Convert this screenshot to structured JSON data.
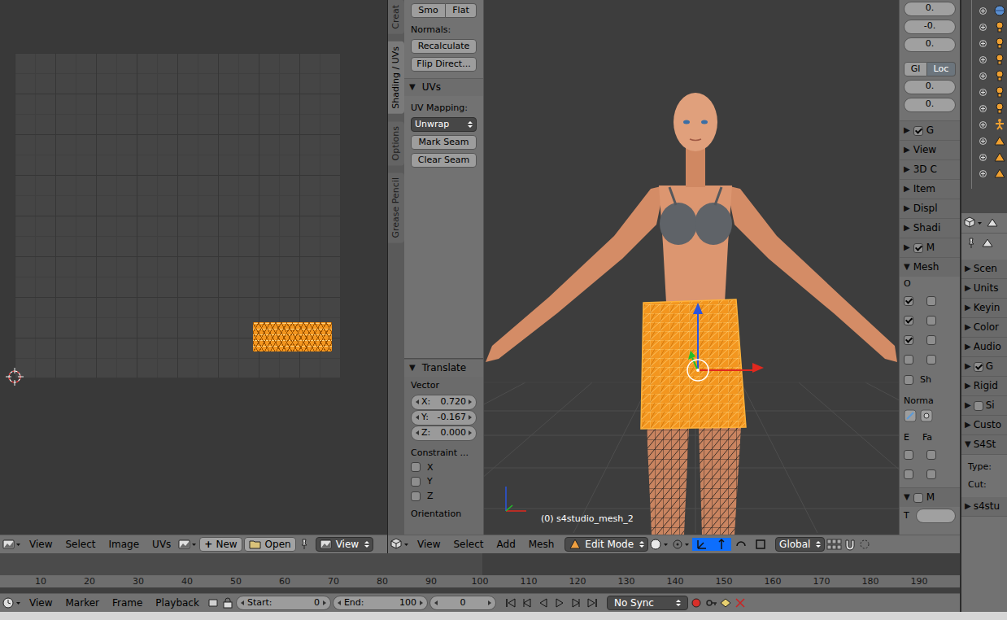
{
  "uv_editor": {
    "header": {
      "menus": [
        "View",
        "Select",
        "Image",
        "UVs"
      ],
      "new_icon": "+",
      "new_label": "New",
      "open_label": "Open",
      "view_label": "View"
    }
  },
  "tool_shelf": {
    "tabs": [
      {
        "label": "Creat",
        "selected": false
      },
      {
        "label": "Shading / UVs",
        "selected": true
      },
      {
        "label": "Options",
        "selected": false
      },
      {
        "label": "Grease Pencil",
        "selected": false
      }
    ],
    "shading_buttons": [
      "Smo",
      "Flat"
    ],
    "normals_label": "Normals:",
    "normals_buttons": [
      "Recalculate",
      "Flip Direct..."
    ],
    "uvs_panel": {
      "arrow": "▼",
      "title": "UVs",
      "mapping_label": "UV Mapping:",
      "mapping_value": "Unwrap",
      "buttons": [
        "Mark Seam",
        "Clear Seam"
      ]
    }
  },
  "operator_panel": {
    "arrow": "▼",
    "title": "Translate",
    "vector_label": "Vector",
    "vector": [
      {
        "label": "X:",
        "value": "0.720"
      },
      {
        "label": "Y:",
        "value": "-0.167"
      },
      {
        "label": "Z:",
        "value": "0.000"
      }
    ],
    "constraint_label": "Constraint ...",
    "constraints": [
      {
        "label": "X",
        "checked": false
      },
      {
        "label": "Y",
        "checked": false
      },
      {
        "label": "Z",
        "checked": false
      }
    ],
    "orientation_label": "Orientation"
  },
  "viewport": {
    "object_label": "(0) s4studio_mesh_2"
  },
  "view3d_header": {
    "menus": [
      "View",
      "Select",
      "Add",
      "Mesh"
    ],
    "mode": "Edit Mode",
    "orientation": "Global",
    "manipulator_toggles": [
      {
        "selected": true
      },
      {
        "selected": true
      },
      {
        "selected": false
      },
      {
        "selected": false
      }
    ]
  },
  "n_panel": {
    "top_fields": [
      "0.",
      "-0.",
      "0."
    ],
    "space_toggle": [
      {
        "label": "Gl",
        "selected": false
      },
      {
        "label": "Loc",
        "selected": true
      }
    ],
    "fields": [
      "0.",
      "0."
    ],
    "panels": [
      {
        "arrow": "▶",
        "label": "G",
        "kind": "checkbox",
        "checked": true
      },
      {
        "arrow": "▶",
        "label": "View",
        "kind": "plain"
      },
      {
        "arrow": "▶",
        "label": "3D C",
        "kind": "plain"
      },
      {
        "arrow": "▶",
        "label": "Item",
        "kind": "plain"
      },
      {
        "arrow": "▶",
        "label": "Displ",
        "kind": "plain"
      },
      {
        "arrow": "▶",
        "label": "Shadi",
        "kind": "plain"
      },
      {
        "arrow": "▶",
        "label": "M",
        "kind": "checkbox",
        "checked": true
      }
    ],
    "mesh_display": {
      "arrow": "▼",
      "label": "Mesh",
      "overlay_label": "O",
      "overlay_rows": [
        {
          "left": true,
          "right": false
        },
        {
          "left": true,
          "right": false
        },
        {
          "left": true,
          "right": false
        },
        {
          "left": false,
          "right": false
        }
      ],
      "sh": {
        "label": "Sh",
        "checked": false
      },
      "normals_label": "Norma",
      "edge_labels": [
        "E",
        "Fa"
      ],
      "edge_rows": [
        {
          "left": false,
          "right": false
        },
        {
          "left": false,
          "right": false
        }
      ],
      "sub": {
        "arrow": "▼",
        "label": "M",
        "checked": false
      },
      "last_label": "T"
    }
  },
  "timeline": {
    "ticks": [
      "10",
      "20",
      "30",
      "40",
      "50",
      "60",
      "70",
      "80",
      "90",
      "100",
      "110",
      "120",
      "130",
      "140",
      "150",
      "160",
      "170",
      "180",
      "190"
    ],
    "menus": [
      "View",
      "Marker",
      "Frame",
      "Playback"
    ],
    "start": {
      "label": "Start:",
      "value": "0"
    },
    "end": {
      "label": "End:",
      "value": "100"
    },
    "current": "0",
    "sync": "No Sync"
  },
  "outliner": {
    "rows": [
      {
        "kind": "world"
      },
      {
        "kind": "lamp"
      },
      {
        "kind": "lamp"
      },
      {
        "kind": "lamp"
      },
      {
        "kind": "lamp"
      },
      {
        "kind": "lamp"
      },
      {
        "kind": "lamp"
      },
      {
        "kind": "armature"
      },
      {
        "kind": "mesh"
      },
      {
        "kind": "mesh"
      },
      {
        "kind": "mesh"
      }
    ]
  },
  "properties": {
    "items": [
      {
        "arrow": "▶",
        "label": "Scen",
        "kind": "plain"
      },
      {
        "arrow": "▶",
        "label": "Units",
        "kind": "plain"
      },
      {
        "arrow": "▶",
        "label": "Keyin",
        "kind": "plain"
      },
      {
        "arrow": "▶",
        "label": "Color",
        "kind": "plain"
      },
      {
        "arrow": "▶",
        "label": "Audio",
        "kind": "plain"
      },
      {
        "arrow": "▶",
        "label": "G",
        "kind": "checkbox",
        "checked": true
      },
      {
        "arrow": "▶",
        "label": "Rigid",
        "kind": "plain"
      },
      {
        "arrow": "▶",
        "label": "Si",
        "kind": "checkbox",
        "checked": false
      },
      {
        "arrow": "▶",
        "label": "Custo",
        "kind": "plain"
      },
      {
        "arrow": "▼",
        "label": "S4St",
        "kind": "plain"
      }
    ],
    "fields": [
      "Type:",
      "Cut:"
    ],
    "footer": {
      "arrow": "▶",
      "label": "s4stu"
    }
  }
}
